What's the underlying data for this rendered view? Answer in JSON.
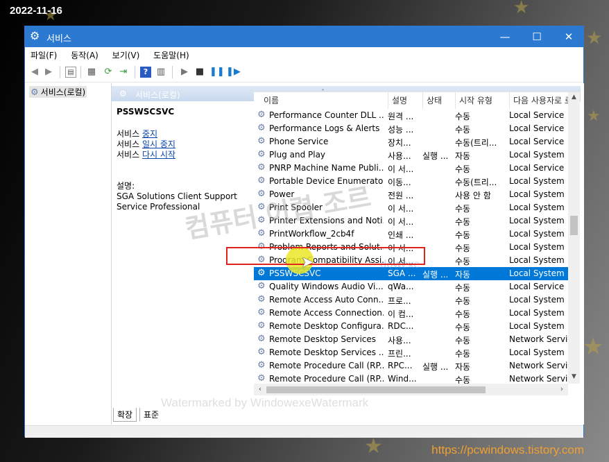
{
  "overlay": {
    "date": "2022-11-16",
    "site_url": "https://pcwindows.tistory.com",
    "watermark_bottom": "Watermarked by WindowexeWatermark",
    "watermark_center": "컴퓨터 어렵 조르",
    "watermark_small": "dowexe"
  },
  "window": {
    "title": "서비스",
    "controls": {
      "minimize": "—",
      "maximize": "☐",
      "close": "✕"
    }
  },
  "menu": [
    "파일(F)",
    "동작(A)",
    "보기(V)",
    "도움말(H)"
  ],
  "tree": {
    "root_label": "서비스(로컬)"
  },
  "pane_header": {
    "label": "서비스(로컬)"
  },
  "detail": {
    "service_name": "PSSWSCSVC",
    "actions": [
      {
        "prefix": "서비스 ",
        "link": "중지"
      },
      {
        "prefix": "서비스 ",
        "link": "일시 중지"
      },
      {
        "prefix": "서비스 ",
        "link": "다시 시작"
      }
    ],
    "description_label": "설명:",
    "description_text": "SGA Solutions Client Support Service Professional"
  },
  "columns": {
    "name": "이름",
    "description": "설명",
    "status": "상태",
    "startup": "시작 유형",
    "logon": "다음 사용자로 로"
  },
  "rows": [
    {
      "name": "Performance Counter DLL ...",
      "desc": "원격 ...",
      "status": "",
      "startup": "수동",
      "logon": "Local Service"
    },
    {
      "name": "Performance Logs & Alerts",
      "desc": "성능 ...",
      "status": "",
      "startup": "수동",
      "logon": "Local Service"
    },
    {
      "name": "Phone Service",
      "desc": "장치...",
      "status": "",
      "startup": "수동(트리...",
      "logon": "Local Service"
    },
    {
      "name": "Plug and Play",
      "desc": "사용...",
      "status": "실행 ...",
      "startup": "자동",
      "logon": "Local System"
    },
    {
      "name": "PNRP Machine Name Publi...",
      "desc": "이 서...",
      "status": "",
      "startup": "수동",
      "logon": "Local Service"
    },
    {
      "name": "Portable Device Enumerato...",
      "desc": "이동...",
      "status": "",
      "startup": "수동(트리...",
      "logon": "Local System"
    },
    {
      "name": "Power",
      "desc": "전원 ...",
      "status": "",
      "startup": "사용 안 함",
      "logon": "Local System"
    },
    {
      "name": "Print Spooler",
      "desc": "이 서...",
      "status": "",
      "startup": "수동",
      "logon": "Local System"
    },
    {
      "name": "Printer Extensions and Noti...",
      "desc": "이 서...",
      "status": "",
      "startup": "수동",
      "logon": "Local System"
    },
    {
      "name": "PrintWorkflow_2cb4f",
      "desc": "인쇄 ...",
      "status": "",
      "startup": "수동",
      "logon": "Local System"
    },
    {
      "name": "Problem Reports and Solut...",
      "desc": "이 서...",
      "status": "",
      "startup": "수동",
      "logon": "Local System"
    },
    {
      "name": "Program Compatibility Assi...",
      "desc": "이 서...",
      "status": "",
      "startup": "수동",
      "logon": "Local System"
    },
    {
      "name": "PSSWSCSVC",
      "desc": "SGA ...",
      "status": "실행 ...",
      "startup": "자동",
      "logon": "Local System",
      "selected": true
    },
    {
      "name": "Quality Windows Audio Vi...",
      "desc": "qWa...",
      "status": "",
      "startup": "수동",
      "logon": "Local Service"
    },
    {
      "name": "Remote Access Auto Conn...",
      "desc": "프로...",
      "status": "",
      "startup": "수동",
      "logon": "Local System"
    },
    {
      "name": "Remote Access Connection...",
      "desc": "이 컴...",
      "status": "",
      "startup": "수동",
      "logon": "Local System"
    },
    {
      "name": "Remote Desktop Configura...",
      "desc": "RDC...",
      "status": "",
      "startup": "수동",
      "logon": "Local System"
    },
    {
      "name": "Remote Desktop Services",
      "desc": "사용...",
      "status": "",
      "startup": "수동",
      "logon": "Network Service"
    },
    {
      "name": "Remote Desktop Services ...",
      "desc": "프린...",
      "status": "",
      "startup": "수동",
      "logon": "Local System"
    },
    {
      "name": "Remote Procedure Call (RP...",
      "desc": "RPC...",
      "status": "실행 ...",
      "startup": "자동",
      "logon": "Network Service"
    },
    {
      "name": "Remote Procedure Call (RP...",
      "desc": "Wind...",
      "status": "",
      "startup": "수동",
      "logon": "Network Service"
    }
  ],
  "tabs": [
    "확장",
    "표준"
  ],
  "colors": {
    "titlebar": "#2b79d0",
    "selection": "#0078d7",
    "highlight_box": "#e0231d",
    "url": "#f0a030"
  }
}
